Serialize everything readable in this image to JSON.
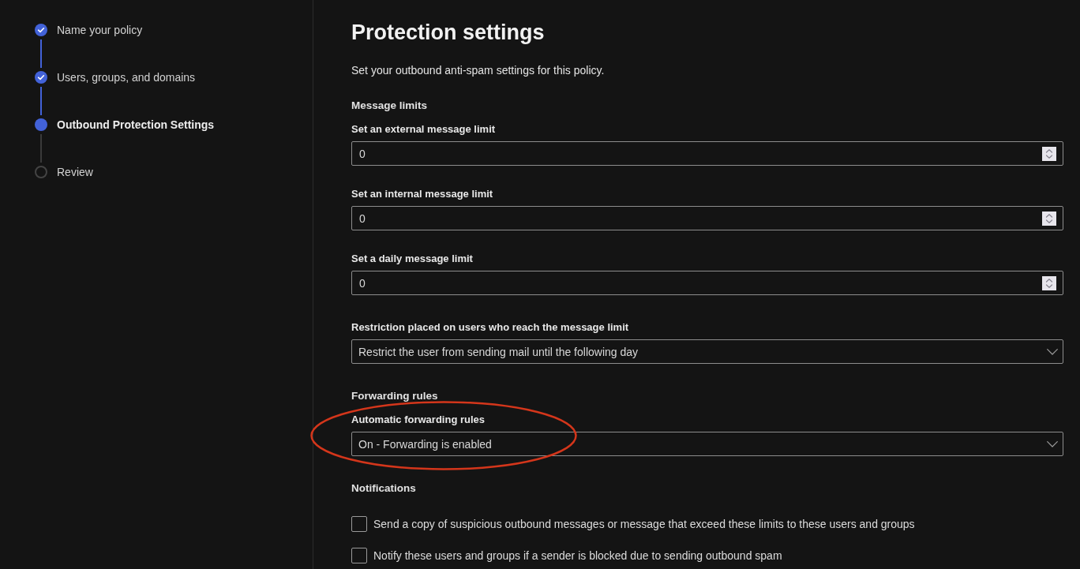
{
  "steps": [
    {
      "label": "Name your policy",
      "completed": true,
      "selected": false
    },
    {
      "label": "Users, groups, and domains",
      "completed": true,
      "selected": false
    },
    {
      "label": "Outbound Protection Settings",
      "completed": false,
      "selected": true
    },
    {
      "label": "Review",
      "completed": false,
      "selected": false
    }
  ],
  "page": {
    "title": "Protection settings",
    "description": "Set your outbound anti-spam settings for this policy."
  },
  "sections": [
    {
      "heading": "Message limits",
      "fields": [
        {
          "kind": "number",
          "label": "Set an external message limit",
          "value": "0",
          "highlighted": false
        },
        {
          "kind": "number",
          "label": "Set an internal message limit",
          "value": "0",
          "highlighted": false
        },
        {
          "kind": "number",
          "label": "Set a daily message limit",
          "value": "0",
          "highlighted": false
        },
        {
          "kind": "dropdown",
          "label": "Restriction placed on users who reach the message limit",
          "value": "Restrict the user from sending mail until the following day",
          "highlighted": false
        }
      ]
    },
    {
      "heading": "Forwarding rules",
      "fields": [
        {
          "kind": "dropdown",
          "label": "Automatic forwarding rules",
          "value": "On - Forwarding is enabled",
          "highlighted": true
        }
      ]
    },
    {
      "heading": "Notifications",
      "fields": [
        {
          "kind": "checkbox",
          "label": "Send a copy of suspicious outbound messages or message that exceed these limits to these users and groups",
          "checked": false
        },
        {
          "kind": "checkbox",
          "label": "Notify these users and groups if a sender is blocked due to sending outbound spam",
          "checked": false
        }
      ]
    }
  ]
}
